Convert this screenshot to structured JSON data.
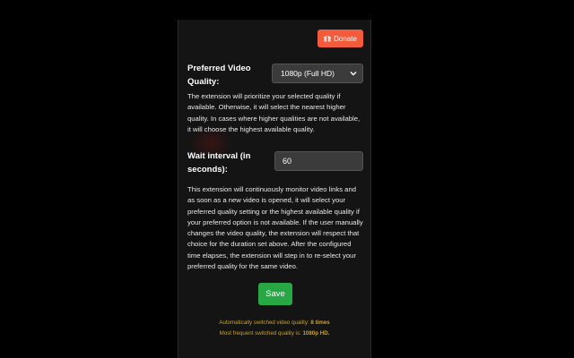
{
  "donate": {
    "label": "Donate",
    "icon": "gift-icon",
    "color": "#f25c3c"
  },
  "quality": {
    "label": "Preferred Video Quality:",
    "selected": "1080p (Full HD)",
    "description": "The extension will prioritize your selected quality if available. Otherwise, it will select the nearest higher quality. In cases where higher qualities are not available, it will choose the highest available quality."
  },
  "wait": {
    "label": "Wait interval (in seconds):",
    "value": "60",
    "description": "This extension will continuously monitor video links and as soon as a new video is opened, it will select your preferred quality setting or the highest available quality if your preferred option is not available. If the user manually changes the video quality, the extension will respect that choice for the duration set above. After the configured time elapses, the extension will step in to re-select your preferred quality for the same video."
  },
  "save": {
    "label": "Save",
    "color": "#28a745"
  },
  "stats": {
    "switched_prefix": "Automatically switched video quality: ",
    "switched_value": "8 times",
    "frequent_prefix": "Most frequent switched quality is: ",
    "frequent_value": "1080p HD."
  },
  "colors": {
    "background": "#000000",
    "panel": "#141414",
    "stats_text": "#c9a227"
  }
}
